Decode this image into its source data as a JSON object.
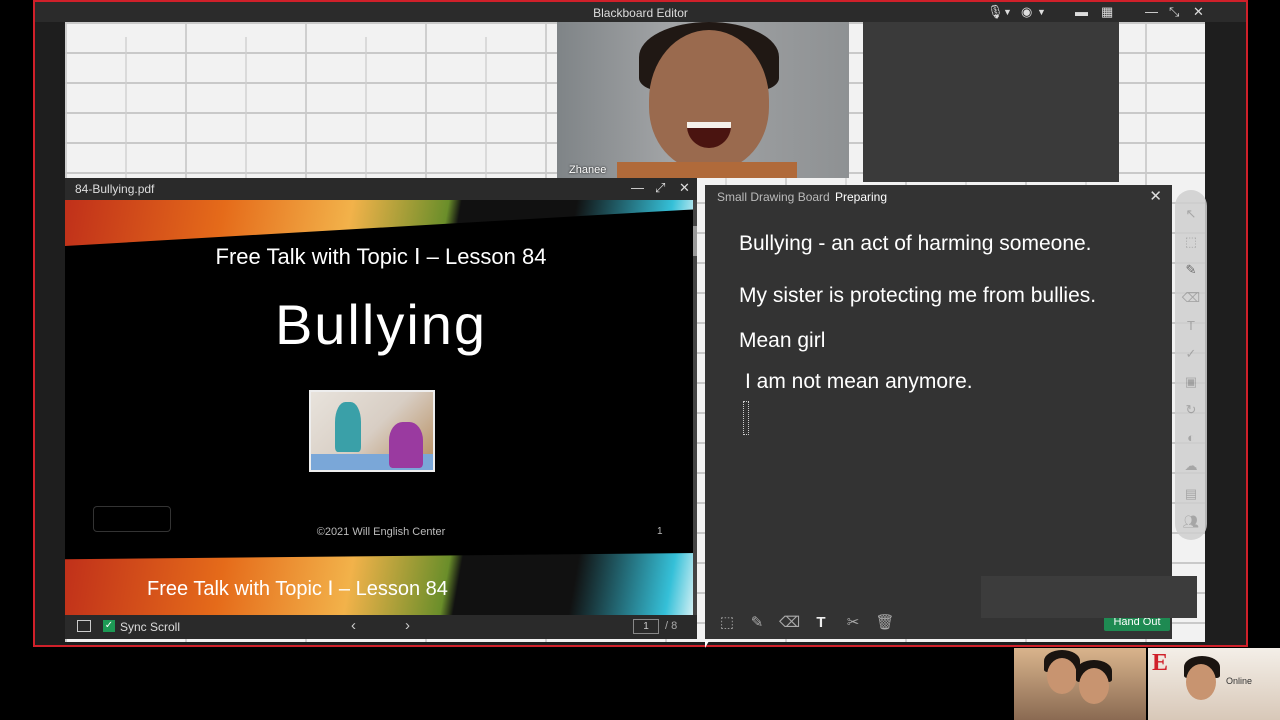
{
  "window": {
    "title": "Blackboard Editor"
  },
  "video": {
    "participant_name": "Zhanee"
  },
  "pdf": {
    "filename": "84-Bullying.pdf",
    "slide": {
      "subtitle": "Free Talk with Topic Ⅰ – Lesson 84",
      "title": "Bullying",
      "copyright": "©2021 Will English Center",
      "page_number": "1",
      "footer": "Free Talk with Topic Ⅰ – Lesson 84"
    },
    "sync_scroll_label": "Sync Scroll",
    "current_page": "1",
    "total_pages": "/ 8"
  },
  "drawing_board": {
    "title": "Small Drawing Board",
    "status": "Preparing",
    "lines": [
      "Bullying - an act of harming someone.",
      "My sister is protecting me from bullies.",
      "Mean girl",
      "I am not mean anymore."
    ],
    "hand_out_label": "Hand Out"
  },
  "thumbnails": {
    "logo_letter": "E",
    "logo_text": "Online"
  },
  "colors": {
    "window_border": "#d0202a",
    "hand_out": "#1e8a52",
    "sync_check": "#1d9a55"
  }
}
